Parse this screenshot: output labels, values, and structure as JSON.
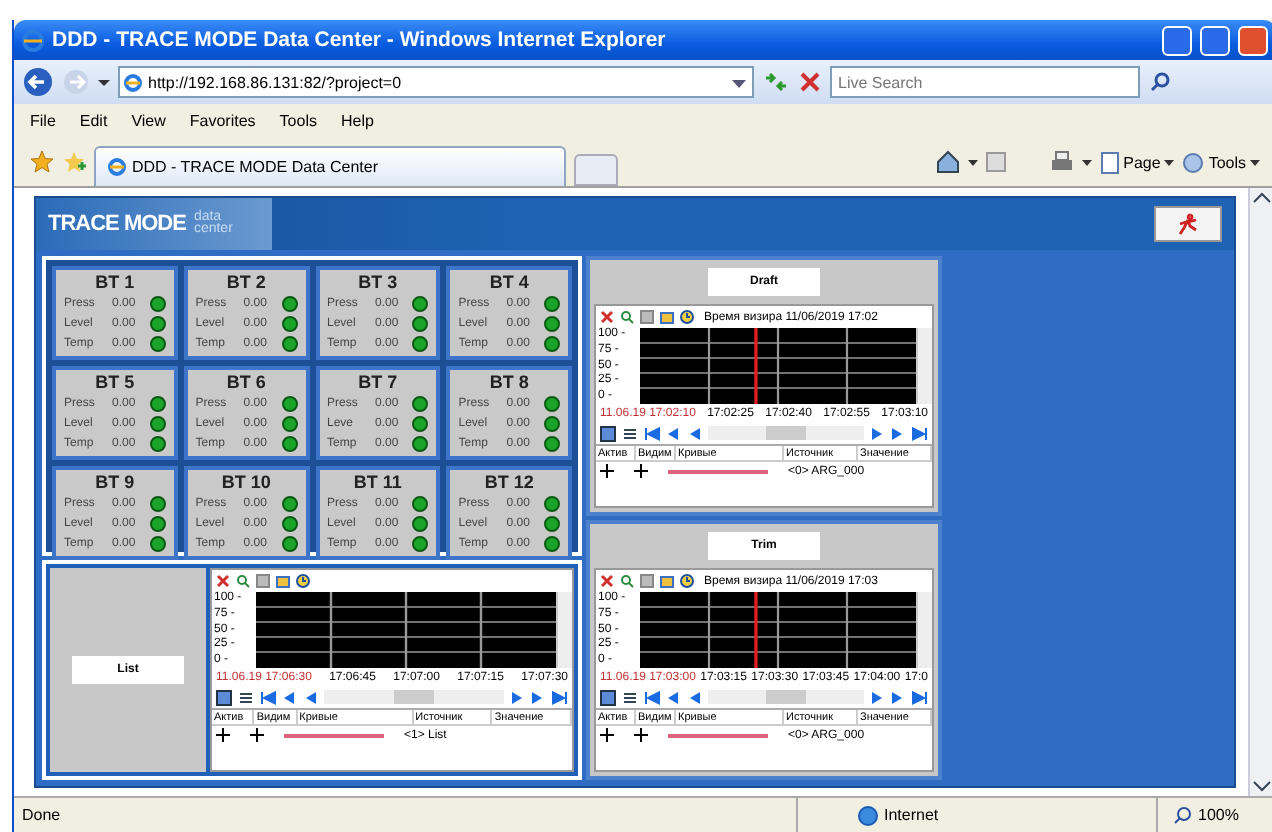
{
  "window": {
    "title": "DDD - TRACE MODE Data Center - Windows Internet Explorer"
  },
  "address_bar": {
    "url": "http://192.168.86.131:82/?project=0"
  },
  "search": {
    "placeholder": "Live Search"
  },
  "menu": [
    "File",
    "Edit",
    "View",
    "Favorites",
    "Tools",
    "Help"
  ],
  "tab": {
    "label": "DDD - TRACE MODE Data Center"
  },
  "command_bar": [
    "Page",
    "Tools"
  ],
  "app": {
    "logo": "TRACE MODE",
    "logo_sub": [
      "data",
      "center"
    ]
  },
  "tanks": [
    {
      "title": "BT 1",
      "rows": [
        {
          "label": "Press",
          "value": "0.00",
          "ok": true
        },
        {
          "label": "Level",
          "value": "0.00",
          "ok": true
        },
        {
          "label": "Temp",
          "value": "0.00",
          "ok": true
        }
      ]
    },
    {
      "title": "BT 2",
      "rows": [
        {
          "label": "Press",
          "value": "0.00",
          "ok": true
        },
        {
          "label": "Level",
          "value": "0.00",
          "ok": true
        },
        {
          "label": "Temp",
          "value": "0.00",
          "ok": true
        }
      ]
    },
    {
      "title": "BT 3",
      "rows": [
        {
          "label": "Press",
          "value": "0.00",
          "ok": true
        },
        {
          "label": "Level",
          "value": "0.00",
          "ok": true
        },
        {
          "label": "Temp",
          "value": "0.00",
          "ok": true
        }
      ]
    },
    {
      "title": "BT 4",
      "rows": [
        {
          "label": "Press",
          "value": "0.00",
          "ok": true
        },
        {
          "label": "Level",
          "value": "0.00",
          "ok": true
        },
        {
          "label": "Temp",
          "value": "0.00",
          "ok": true
        }
      ]
    },
    {
      "title": "BT 5",
      "rows": [
        {
          "label": "Press",
          "value": "0.00",
          "ok": true
        },
        {
          "label": "Level",
          "value": "0.00",
          "ok": true
        },
        {
          "label": "Temp",
          "value": "0.00",
          "ok": true
        }
      ]
    },
    {
      "title": "BT 6",
      "rows": [
        {
          "label": "Press",
          "value": "0.00",
          "ok": true
        },
        {
          "label": "Level",
          "value": "0.00",
          "ok": true
        },
        {
          "label": "Temp",
          "value": "0.00",
          "ok": true
        }
      ]
    },
    {
      "title": "BT 7",
      "rows": [
        {
          "label": "Press",
          "value": "0.00",
          "ok": true
        },
        {
          "label": "Leve",
          "value": "0.00",
          "ok": true
        },
        {
          "label": "Temp",
          "value": "0.00",
          "ok": true
        }
      ]
    },
    {
      "title": "BT 8",
      "rows": [
        {
          "label": "Press",
          "value": "0.00",
          "ok": true
        },
        {
          "label": "Level",
          "value": "0.00",
          "ok": true
        },
        {
          "label": "Temp",
          "value": "0.00",
          "ok": true
        }
      ]
    },
    {
      "title": "BT 9",
      "rows": [
        {
          "label": "Press",
          "value": "0.00",
          "ok": true
        },
        {
          "label": "Level",
          "value": "0.00",
          "ok": true
        },
        {
          "label": "Temp",
          "value": "0.00",
          "ok": true
        }
      ]
    },
    {
      "title": "BT 10",
      "rows": [
        {
          "label": "Press",
          "value": "0.00",
          "ok": true
        },
        {
          "label": "Level",
          "value": "0.00",
          "ok": true
        },
        {
          "label": "Temp",
          "value": "0.00",
          "ok": true
        }
      ]
    },
    {
      "title": "BT 11",
      "rows": [
        {
          "label": "Press",
          "value": "0.00",
          "ok": true
        },
        {
          "label": "Level",
          "value": "0.00",
          "ok": true
        },
        {
          "label": "Temp",
          "value": "0.00",
          "ok": true
        }
      ]
    },
    {
      "title": "BT 12",
      "rows": [
        {
          "label": "Press",
          "value": "0.00",
          "ok": true
        },
        {
          "label": "Level",
          "value": "0.00",
          "ok": true
        },
        {
          "label": "Temp",
          "value": "0.00",
          "ok": true
        }
      ]
    }
  ],
  "list_trend": {
    "label": "List",
    "y_ticks": [
      "100 -",
      "75 -",
      "50 -",
      "25 -",
      "0 -"
    ],
    "start": "11.06.19 17:06:30",
    "ticks": [
      "17:06:45",
      "17:07:00",
      "17:07:15",
      "17:07:30"
    ],
    "cursor": false,
    "columns": [
      "Актив",
      "Видим",
      "Кривые",
      "Источник",
      "Значение"
    ],
    "source": "<1> List"
  },
  "middle_trends": [
    {
      "label": "Draft",
      "cursor_time": "Время визира 11/06/2019 17:02",
      "y_ticks": [
        "100 -",
        "75 -",
        "50 -",
        "25 -",
        "0 -"
      ],
      "start": "11.06.19 17:02:10",
      "ticks": [
        "17:02:25",
        "17:02:40",
        "17:02:55",
        "17:03:10"
      ],
      "cursor": true,
      "columns": [
        "Актив",
        "Видим",
        "Кривые",
        "Источник",
        "Значение"
      ],
      "source": "<0> ARG_000"
    },
    {
      "label": "Trim",
      "cursor_time": "Время визира 11/06/2019 17:03",
      "y_ticks": [
        "100 -",
        "75 -",
        "50 -",
        "25 -",
        "0 -"
      ],
      "start": "11.06.19 17:03:00",
      "ticks": [
        "17:03:15",
        "17:03:30",
        "17:03:45",
        "17:04:00",
        "17:0"
      ],
      "cursor": true,
      "columns": [
        "Актив",
        "Видим",
        "Кривые",
        "Источник",
        "Значение"
      ],
      "source": "<0> ARG_000"
    }
  ],
  "status_bar": {
    "text": "Done",
    "zone": "Internet",
    "zoom": "100%"
  }
}
